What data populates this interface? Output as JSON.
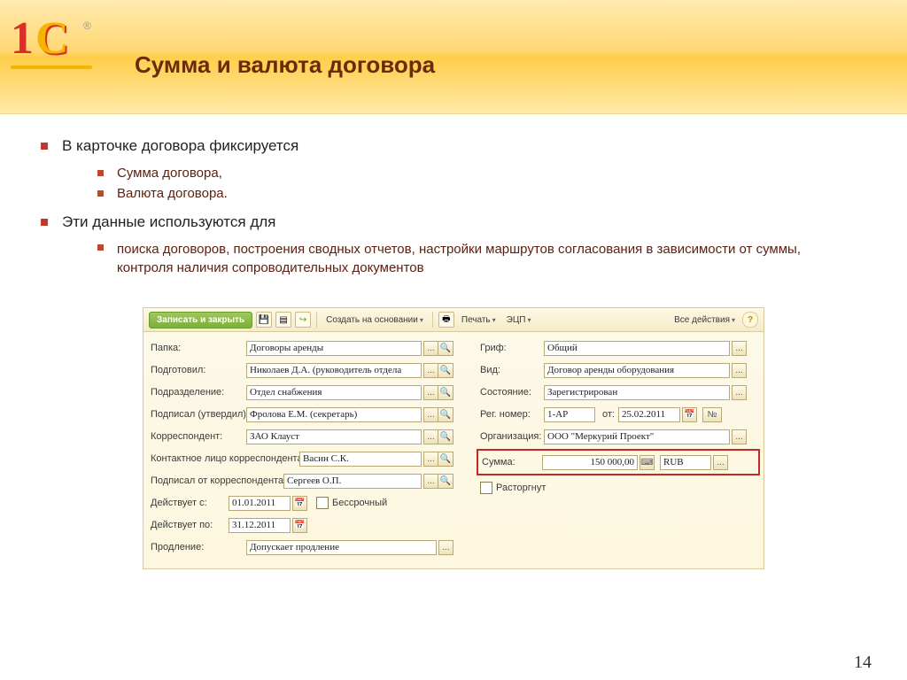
{
  "slide": {
    "title": "Сумма и валюта договора",
    "pageNumber": "14"
  },
  "bullets": {
    "top1": "В карточке договора фиксируется",
    "sub1": "Сумма договора,",
    "sub2": "Валюта договора.",
    "top2": "Эти данные используются для",
    "sub3": "поиска договоров, построения сводных отчетов, настройки маршрутов согласования в зависимости от суммы, контроля наличия сопроводительных документов"
  },
  "toolbar": {
    "save": "Записать и закрыть",
    "createOn": "Создать на основании",
    "print": "Печать",
    "eds": "ЭЦП",
    "allActions": "Все действия"
  },
  "labels": {
    "folder": "Папка:",
    "prepared": "Подготовил:",
    "department": "Подразделение:",
    "signed": "Подписал (утвердил):",
    "correspondent": "Корреспондент:",
    "contact": "Контактное лицо корреспондента:",
    "signedFrom": "Подписал от корреспондента:",
    "validFrom": "Действует с:",
    "validTo": "Действует по:",
    "renewal": "Продление:",
    "grif": "Гриф:",
    "kind": "Вид:",
    "state": "Состояние:",
    "regNo": "Рег. номер:",
    "from": "от:",
    "org": "Организация:",
    "sum": "Сумма:",
    "terminated": "Расторгнут",
    "perpetual": "Бессрочный",
    "noBtn": "№"
  },
  "values": {
    "folder": "Договоры аренды",
    "prepared": "Николаев Д.А. (руководитель отдела",
    "department": "Отдел снабжения",
    "signed": "Фролова Е.М. (секретарь)",
    "correspondent": "ЗАО Клауст",
    "contact": "Васин С.К.",
    "signedFrom": "Сергеев О.П.",
    "validFrom": "01.01.2011",
    "validTo": "31.12.2011",
    "renewal": "Допускает продление",
    "grif": "Общий",
    "kind": "Договор аренды оборудования",
    "state": "Зарегистрирован",
    "regNo": "1-АР",
    "regDate": "25.02.2011",
    "org": "ООО \"Меркурий Проект\"",
    "sum": "150 000,00",
    "currency": "RUB"
  }
}
